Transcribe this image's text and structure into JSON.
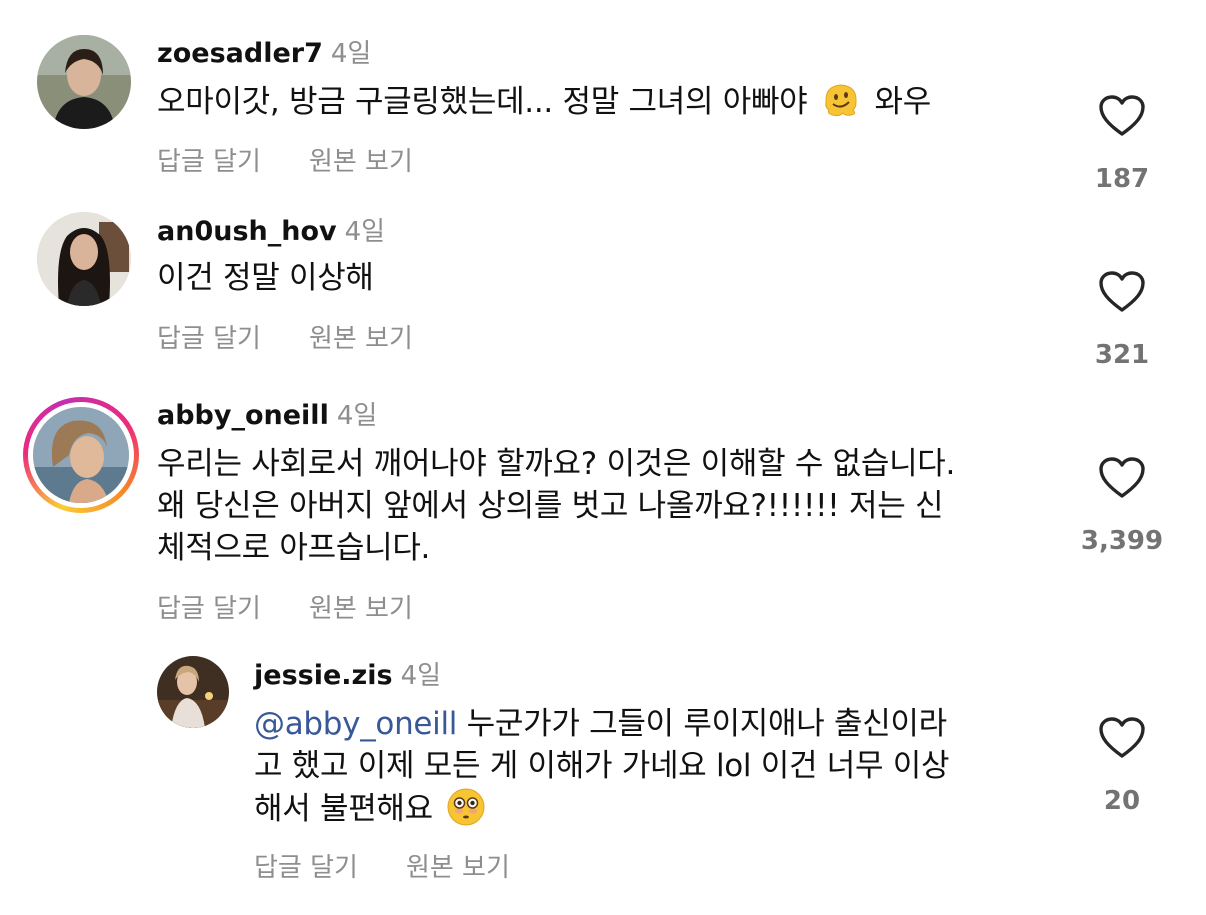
{
  "comments": [
    {
      "username": "zoesadler7",
      "time": "4일",
      "text": "오마이갓, 방금 구글링했는데... 정말 그녀의 아빠야",
      "text_after": "와우",
      "emoji": "melting-face-emoji",
      "reply_label": "답글 달기",
      "view_original_label": "원본 보기",
      "likes": "187"
    },
    {
      "username": "an0ush_hov",
      "time": "4일",
      "text": "이건 정말 이상해",
      "reply_label": "답글 달기",
      "view_original_label": "원본 보기",
      "likes": "321"
    },
    {
      "username": "abby_oneill",
      "time": "4일",
      "text_lines": [
        "우리는 사회로서 깨어나야 할까요? 이것은 이해할 수 없습니다.",
        "왜 당신은 아버지 앞에서 상의를 벗고 나올까요?!!!!!! 저는 신",
        "체적으로 아프습니다."
      ],
      "has_story_ring": true,
      "reply_label": "답글 달기",
      "view_original_label": "원본 보기",
      "likes": "3,399"
    }
  ],
  "reply": {
    "username": "jessie.zis",
    "time": "4일",
    "mention": "@abby_oneill",
    "text_line1": " 누군가가 그들이 루이지애나 출신이라",
    "text_line2": "고 했고 이제 모든 게 이해가 가네요 lol 이건 너무 이상",
    "text_line3": "해서 불편해요",
    "emoji": "flushed-face-emoji",
    "reply_label": "답글 달기",
    "view_original_label": "원본 보기",
    "likes": "20"
  },
  "colors": {
    "mention": "#385898",
    "muted": "#8e8e8e",
    "emoji_yellow": "#f7c533"
  },
  "icons": [
    "heart-outline-icon"
  ]
}
